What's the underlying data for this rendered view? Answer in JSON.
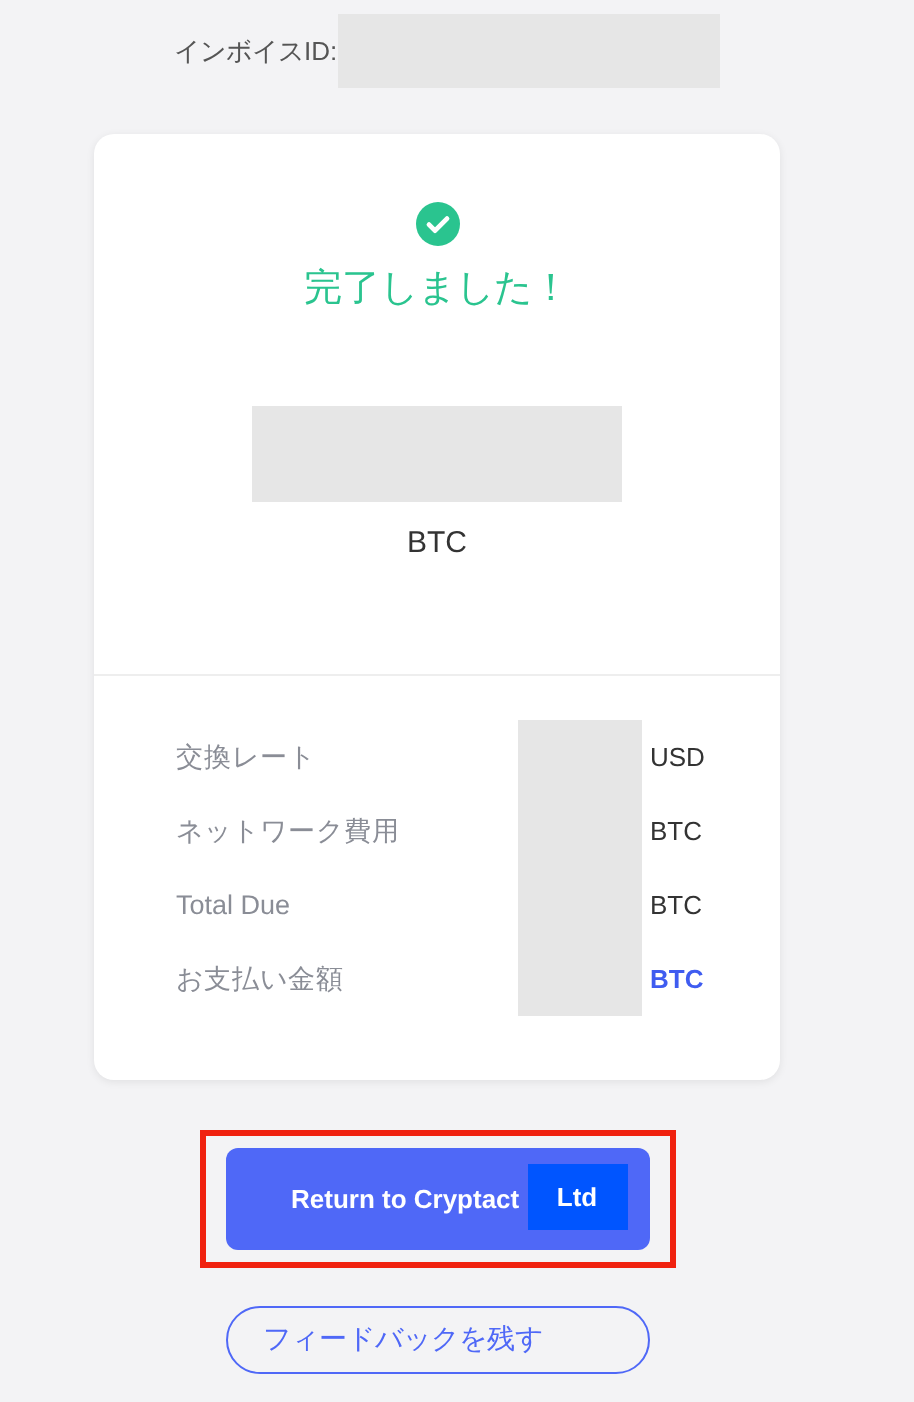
{
  "invoice": {
    "label": "インボイスID:",
    "redacted": true
  },
  "status": {
    "title": "完了しました！",
    "done": true
  },
  "amount": {
    "redacted": true,
    "currency": "BTC"
  },
  "details": [
    {
      "label": "交換レート",
      "unit": "USD",
      "highlight": false
    },
    {
      "label": "ネットワーク費用",
      "unit": "BTC",
      "highlight": false
    },
    {
      "label": "Total Due",
      "unit": "BTC",
      "highlight": false
    },
    {
      "label": "お支払い金額",
      "unit": "BTC",
      "highlight": true
    }
  ],
  "return_button": {
    "label": "Return to Cryptact",
    "badge": "Ltd",
    "outlined": true
  },
  "feedback_button": {
    "label": "フィードバックを残す"
  }
}
